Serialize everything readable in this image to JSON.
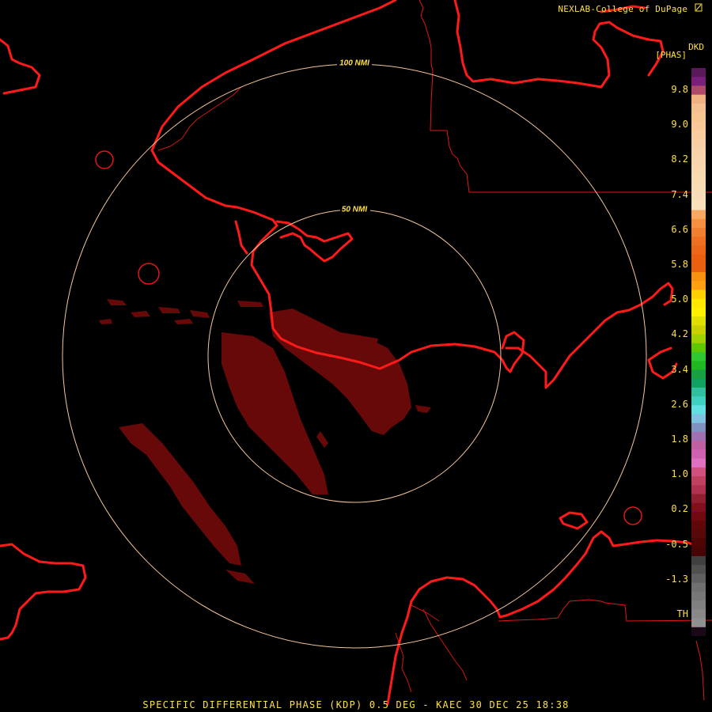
{
  "credit": "NEXLAB-College of DuPage",
  "credit_logo": "cod-logo-icon",
  "product_code": "DKD",
  "units": "[PHAS]",
  "range_rings": [
    {
      "label": "100 NMI"
    },
    {
      "label": "50 NMI"
    }
  ],
  "footer": "SPECIFIC DIFFERENTIAL PHASE (KDP) 0.5 DEG - KAEC 30 DEC 25 18:38",
  "legend": {
    "ticks": [
      "9.8",
      "9.0",
      "8.2",
      "7.4",
      "6.6",
      "5.8",
      "5.0",
      "4.2",
      "3.4",
      "2.6",
      "1.8",
      "1.0",
      "0.2",
      "-0.5",
      "-1.3",
      "TH"
    ],
    "colors": {
      "ring": "#f5c69a",
      "coast": "#ff1a1a",
      "border": "#ff2020",
      "echo": "#6e0a0a",
      "text": "#ffe040"
    }
  }
}
